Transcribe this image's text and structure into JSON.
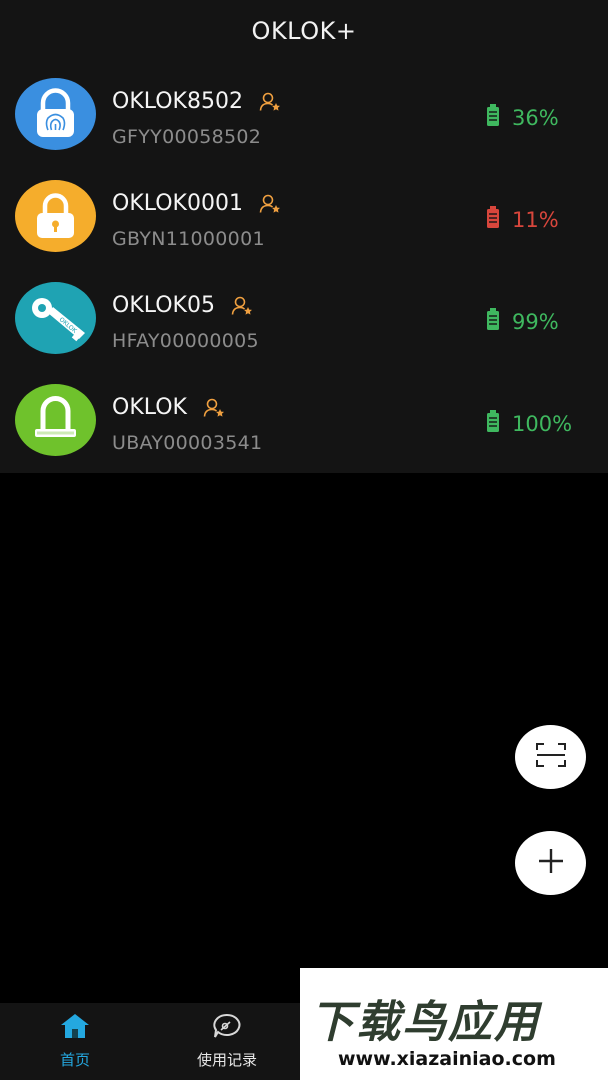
{
  "header": {
    "title": "OKLOK+"
  },
  "colors": {
    "ok": "#3fb85f",
    "low": "#d8463c",
    "accent": "#f0a040",
    "tab_active": "#24a8e0"
  },
  "devices": [
    {
      "name": "OKLOK8502",
      "serial": "GFYY00058502",
      "battery": "36%",
      "battery_status": "ok",
      "icon": "fingerprint-padlock-icon"
    },
    {
      "name": "OKLOK0001",
      "serial": "GBYN11000001",
      "battery": "11%",
      "battery_status": "low",
      "icon": "padlock-icon"
    },
    {
      "name": "OKLOK05",
      "serial": "HFAY00000005",
      "battery": "99%",
      "battery_status": "ok",
      "icon": "key-icon"
    },
    {
      "name": "OKLOK",
      "serial": "UBAY00003541",
      "battery": "100%",
      "battery_status": "ok",
      "icon": "u-lock-icon"
    }
  ],
  "tabs": [
    {
      "label": "首页",
      "icon": "home-icon",
      "active": true
    },
    {
      "label": "使用记录",
      "icon": "records-icon",
      "active": false
    }
  ],
  "watermark": {
    "title": "下载鸟应用",
    "url": "www.xiazainiao.com"
  }
}
